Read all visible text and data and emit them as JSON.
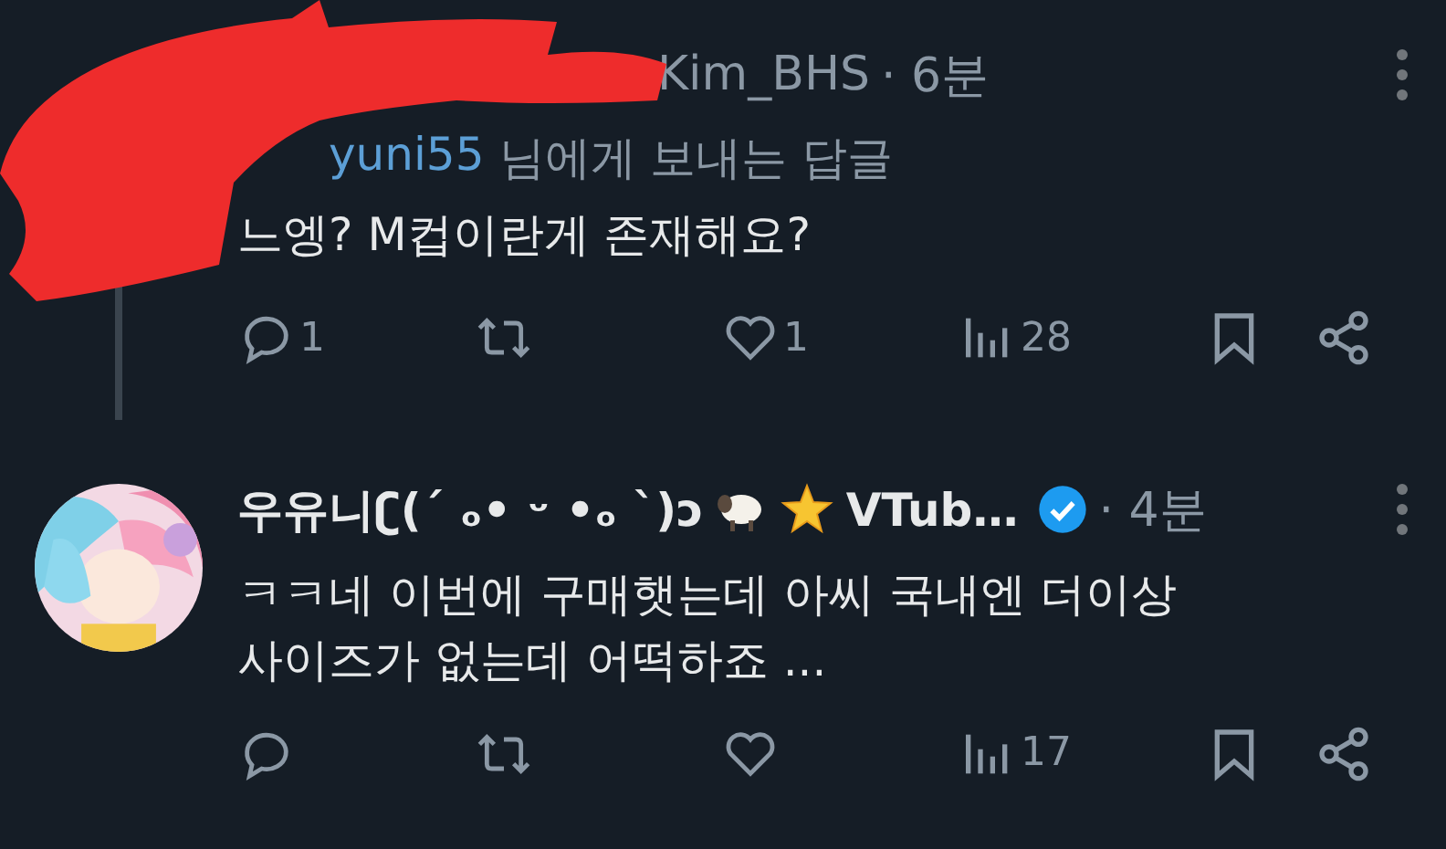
{
  "tweets": [
    {
      "kind": "reply",
      "author": "Kim_BHS",
      "time": "· 6분",
      "reply_to": {
        "handle": "yuni55",
        "suffix": "님에게 보내는 답글"
      },
      "text": "느엥? M컵이란게 존재해요?",
      "actions": [
        {
          "kind": "reply",
          "count": "1"
        },
        {
          "kind": "retweet"
        },
        {
          "kind": "like",
          "count": "1"
        },
        {
          "kind": "views",
          "count": "28"
        },
        {
          "kind": "bookmark"
        },
        {
          "kind": "share"
        }
      ]
    },
    {
      "kind": "post",
      "author": "우유니ʗ(´ ₒ• ᵕ •ₒ `)ɔ",
      "author_end": "VTub…",
      "verified": true,
      "time": "· 4분",
      "text": "ㅋㅋ네 이번에 구매햇는데 아씨 국내엔 더이상\n사이즈가 없는데 어떡하죠 ...",
      "actions": [
        {
          "kind": "reply"
        },
        {
          "kind": "retweet"
        },
        {
          "kind": "like"
        },
        {
          "kind": "views",
          "count": "17"
        },
        {
          "kind": "bookmark"
        },
        {
          "kind": "share"
        }
      ]
    }
  ]
}
